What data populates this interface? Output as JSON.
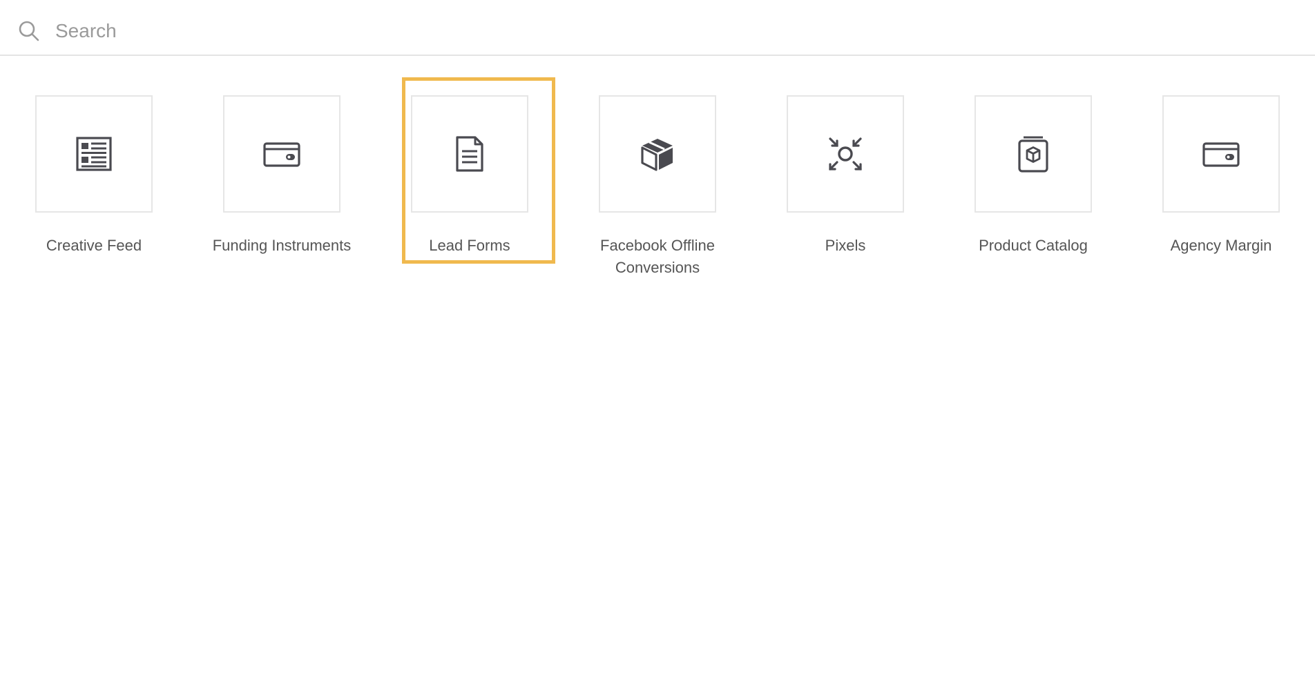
{
  "search": {
    "placeholder": "Search",
    "value": ""
  },
  "colors": {
    "icon": "#4a4a50",
    "tile_border": "#e6e6e6",
    "selection": "#f0b94e",
    "label": "#555555"
  },
  "tiles": [
    {
      "label": "Creative Feed",
      "icon": "feed-icon",
      "selected": false
    },
    {
      "label": "Funding Instruments",
      "icon": "wallet-card-icon",
      "selected": false
    },
    {
      "label": "Lead Forms",
      "icon": "document-icon",
      "selected": true
    },
    {
      "label": "Facebook Offline Conversions",
      "icon": "box-icon",
      "selected": false
    },
    {
      "label": "Pixels",
      "icon": "target-arrows-icon",
      "selected": false
    },
    {
      "label": "Product Catalog",
      "icon": "catalog-box-icon",
      "selected": false
    },
    {
      "label": "Agency Margin",
      "icon": "wallet-card-icon",
      "selected": false
    }
  ]
}
